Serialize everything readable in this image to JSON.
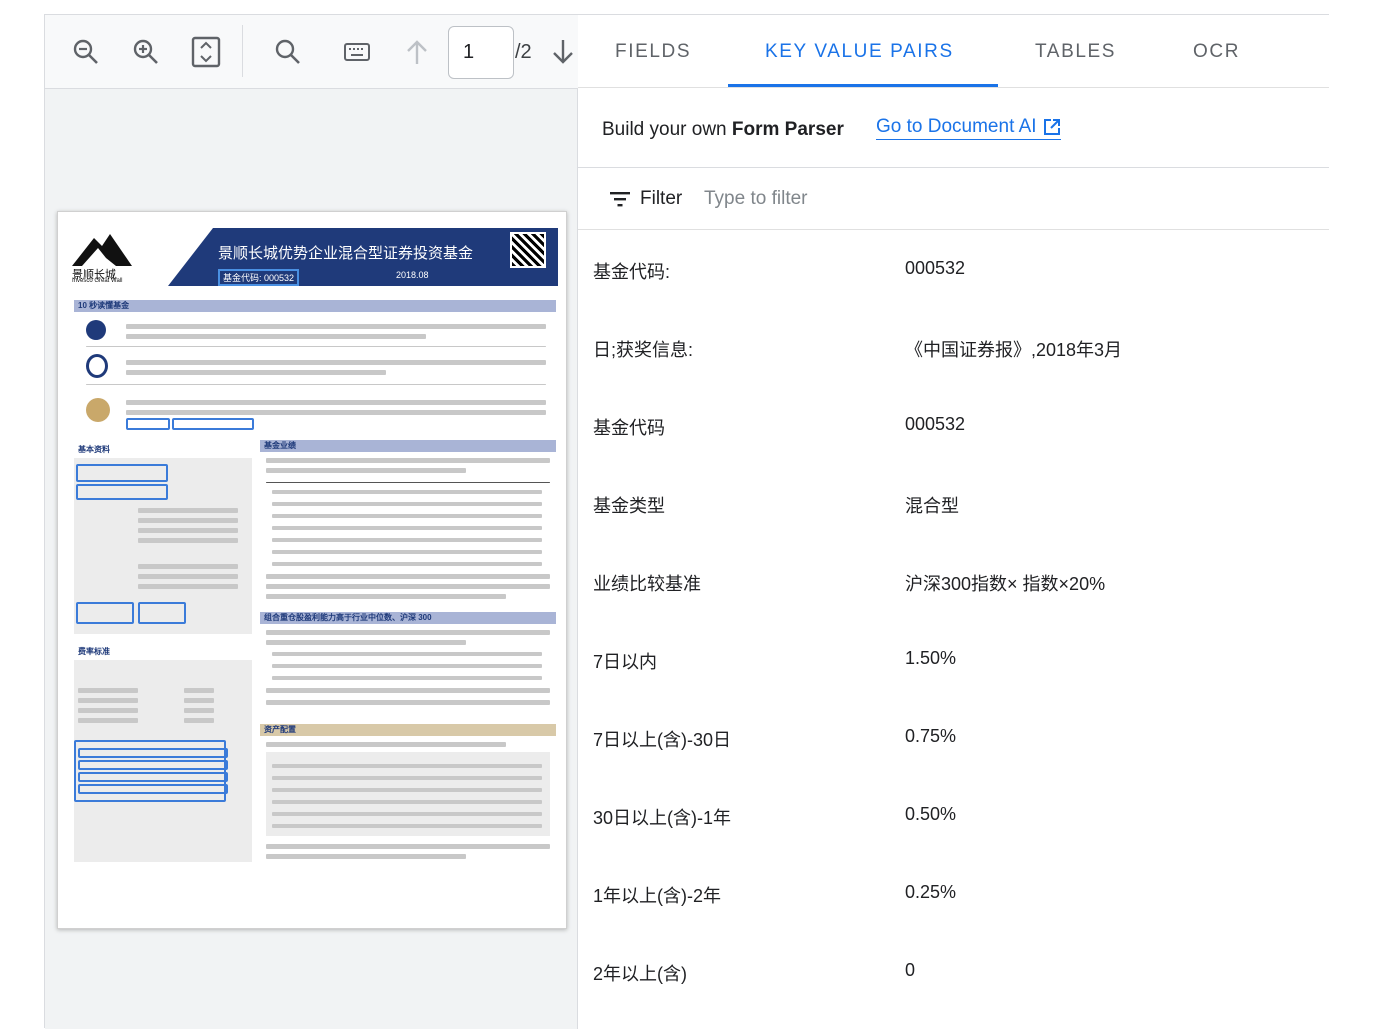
{
  "toolbar": {
    "page_current": "1",
    "page_total": "/2",
    "icons": [
      "zoom-out-icon",
      "zoom-in-icon",
      "fit-page-icon",
      "search-icon",
      "keyboard-icon",
      "arrow-up-icon",
      "arrow-down-icon"
    ]
  },
  "document_preview": {
    "logo_cn": "景顺长城",
    "logo_en": "Invesco Great Wall",
    "title": "景顺长城优势企业混合型证券投资基金",
    "fund_code": "基金代码: 000532",
    "date": "2018.08",
    "section_1": "10 秒读懂基金",
    "section_basic": "基本资料",
    "section_perf": "基金业绩",
    "section_fee": "费率标准",
    "section_holdings": "组合重仓股盈利能力高于行业中位数、沪深 300",
    "section_alloc": "资产配置"
  },
  "tabs": [
    {
      "label": "FIELDS",
      "active": false
    },
    {
      "label": "KEY VALUE PAIRS",
      "active": true
    },
    {
      "label": "TABLES",
      "active": false
    },
    {
      "label": "OCR",
      "active": false
    }
  ],
  "build": {
    "prefix": "Build your own ",
    "bold": "Form Parser",
    "link": "Go to Document AI"
  },
  "filter": {
    "label": "Filter",
    "placeholder": "Type to filter"
  },
  "kv_pairs": [
    {
      "key": "基金代码:",
      "value": "000532"
    },
    {
      "key": "日;获奖信息:",
      "value": "《中国证券报》,2018年3月"
    },
    {
      "key": "基金代码",
      "value": "000532"
    },
    {
      "key": "基金类型",
      "value": "混合型"
    },
    {
      "key": "业绩比较基准",
      "value": "沪深300指数× 指数×20%"
    },
    {
      "key": "7日以内",
      "value": "1.50%"
    },
    {
      "key": "7日以上(含)-30日",
      "value": "0.75%"
    },
    {
      "key": "30日以上(含)-1年",
      "value": "0.50%"
    },
    {
      "key": "1年以上(含)-2年",
      "value": "0.25%"
    },
    {
      "key": "2年以上(含)",
      "value": "0"
    }
  ],
  "colors": {
    "accent": "#1a73e8",
    "banner": "#1f3a7a",
    "highlight": "#3b7bd9"
  }
}
